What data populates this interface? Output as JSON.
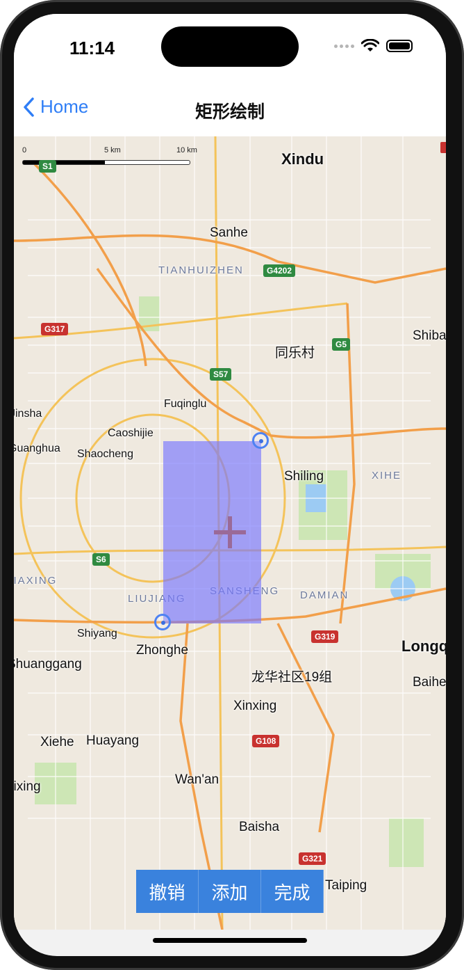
{
  "status_bar": {
    "time": "11:14"
  },
  "navbar": {
    "back_label": "Home",
    "title": "矩形绘制"
  },
  "scale": {
    "labels": [
      "0",
      "5 km",
      "10 km"
    ]
  },
  "map": {
    "place_labels": [
      "Xindu",
      "Sanhe",
      "同乐村",
      "Shiba",
      "Fuqinglu",
      "Caoshijie",
      "Shaocheng",
      "Shiling",
      "Jinsha",
      "Guanghua",
      "Shiyang",
      "Zhonghe",
      "Longq",
      "Shuanggang",
      "龙华社区19组",
      "Baihe",
      "Xinxing",
      "Xiehe",
      "Huayang",
      "Wan'an",
      "Baisha",
      "Taiping",
      "Jixing"
    ],
    "district_labels": [
      "TIANHUIZHEN",
      "XIHE",
      "LIUJIANG",
      "SANSHENG",
      "DAMIAN",
      "JIAXING"
    ],
    "route_shields": {
      "red": [
        "G317",
        "G319",
        "G108",
        "G321"
      ],
      "green": [
        "S1",
        "G4202",
        "G5",
        "S57",
        "S6"
      ]
    },
    "rect_fill_color": "#7676ff",
    "handle_color": "#4d82f2"
  },
  "toolbar": {
    "undo_label": "撤销",
    "add_label": "添加",
    "done_label": "完成",
    "button_color": "#3a82dd"
  }
}
